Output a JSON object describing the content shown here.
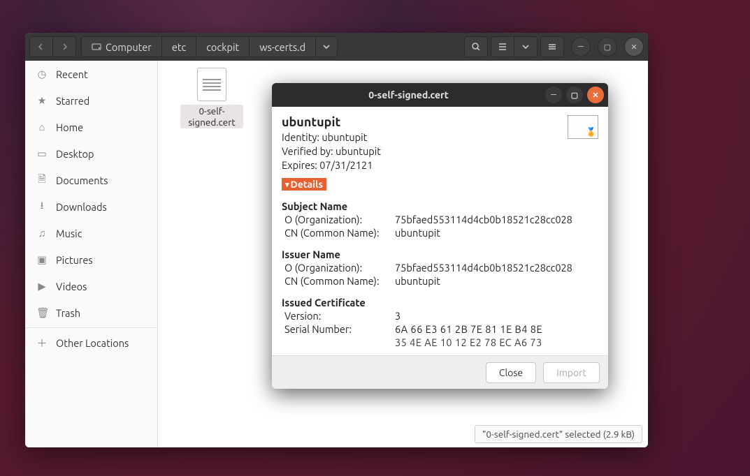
{
  "fm": {
    "breadcrumbs": [
      "Computer",
      "etc",
      "cockpit",
      "ws-certs.d"
    ],
    "sidebar": [
      {
        "id": "recent",
        "label": "Recent",
        "icon": "clock-icon"
      },
      {
        "id": "starred",
        "label": "Starred",
        "icon": "star-icon"
      },
      {
        "id": "home",
        "label": "Home",
        "icon": "home-icon"
      },
      {
        "id": "desktop",
        "label": "Desktop",
        "icon": "desktop-icon"
      },
      {
        "id": "documents",
        "label": "Documents",
        "icon": "documents-icon"
      },
      {
        "id": "downloads",
        "label": "Downloads",
        "icon": "downloads-icon"
      },
      {
        "id": "music",
        "label": "Music",
        "icon": "music-icon"
      },
      {
        "id": "pictures",
        "label": "Pictures",
        "icon": "pictures-icon"
      },
      {
        "id": "videos",
        "label": "Videos",
        "icon": "videos-icon"
      },
      {
        "id": "trash",
        "label": "Trash",
        "icon": "trash-icon"
      }
    ],
    "other_locations_label": "Other Locations",
    "file": {
      "name": "0-self-signed.cert"
    },
    "statusbar": "\"0-self-signed.cert\" selected  (2.9 kB)"
  },
  "dlg": {
    "title": "0-self-signed.cert",
    "cn": "ubuntupit",
    "identity_label": "Identity:",
    "identity_value": "ubuntupit",
    "verified_label": "Verified by:",
    "verified_value": "ubuntupit",
    "expires_label": "Expires:",
    "expires_value": "07/31/2121",
    "details_label": "Details",
    "subject_heading": "Subject Name",
    "issuer_heading": "Issuer Name",
    "issued_cert_heading": "Issued Certificate",
    "o_label": "O (Organization):",
    "cn_label": "CN (Common Name):",
    "version_label": "Version:",
    "serial_label": "Serial Number:",
    "subject_o": "75bfaed553114d4cb0b18521c28cc028",
    "subject_cn": "ubuntupit",
    "issuer_o": "75bfaed553114d4cb0b18521c28cc028",
    "issuer_cn": "ubuntupit",
    "version": "3",
    "serial_line1": "6A  66  E3  61  2B  7E  81  1E  B4  8E",
    "serial_line2": "35  4E  AE  10  12  E2  78  EC  A6  73",
    "close_label": "Close",
    "import_label": "Import"
  }
}
